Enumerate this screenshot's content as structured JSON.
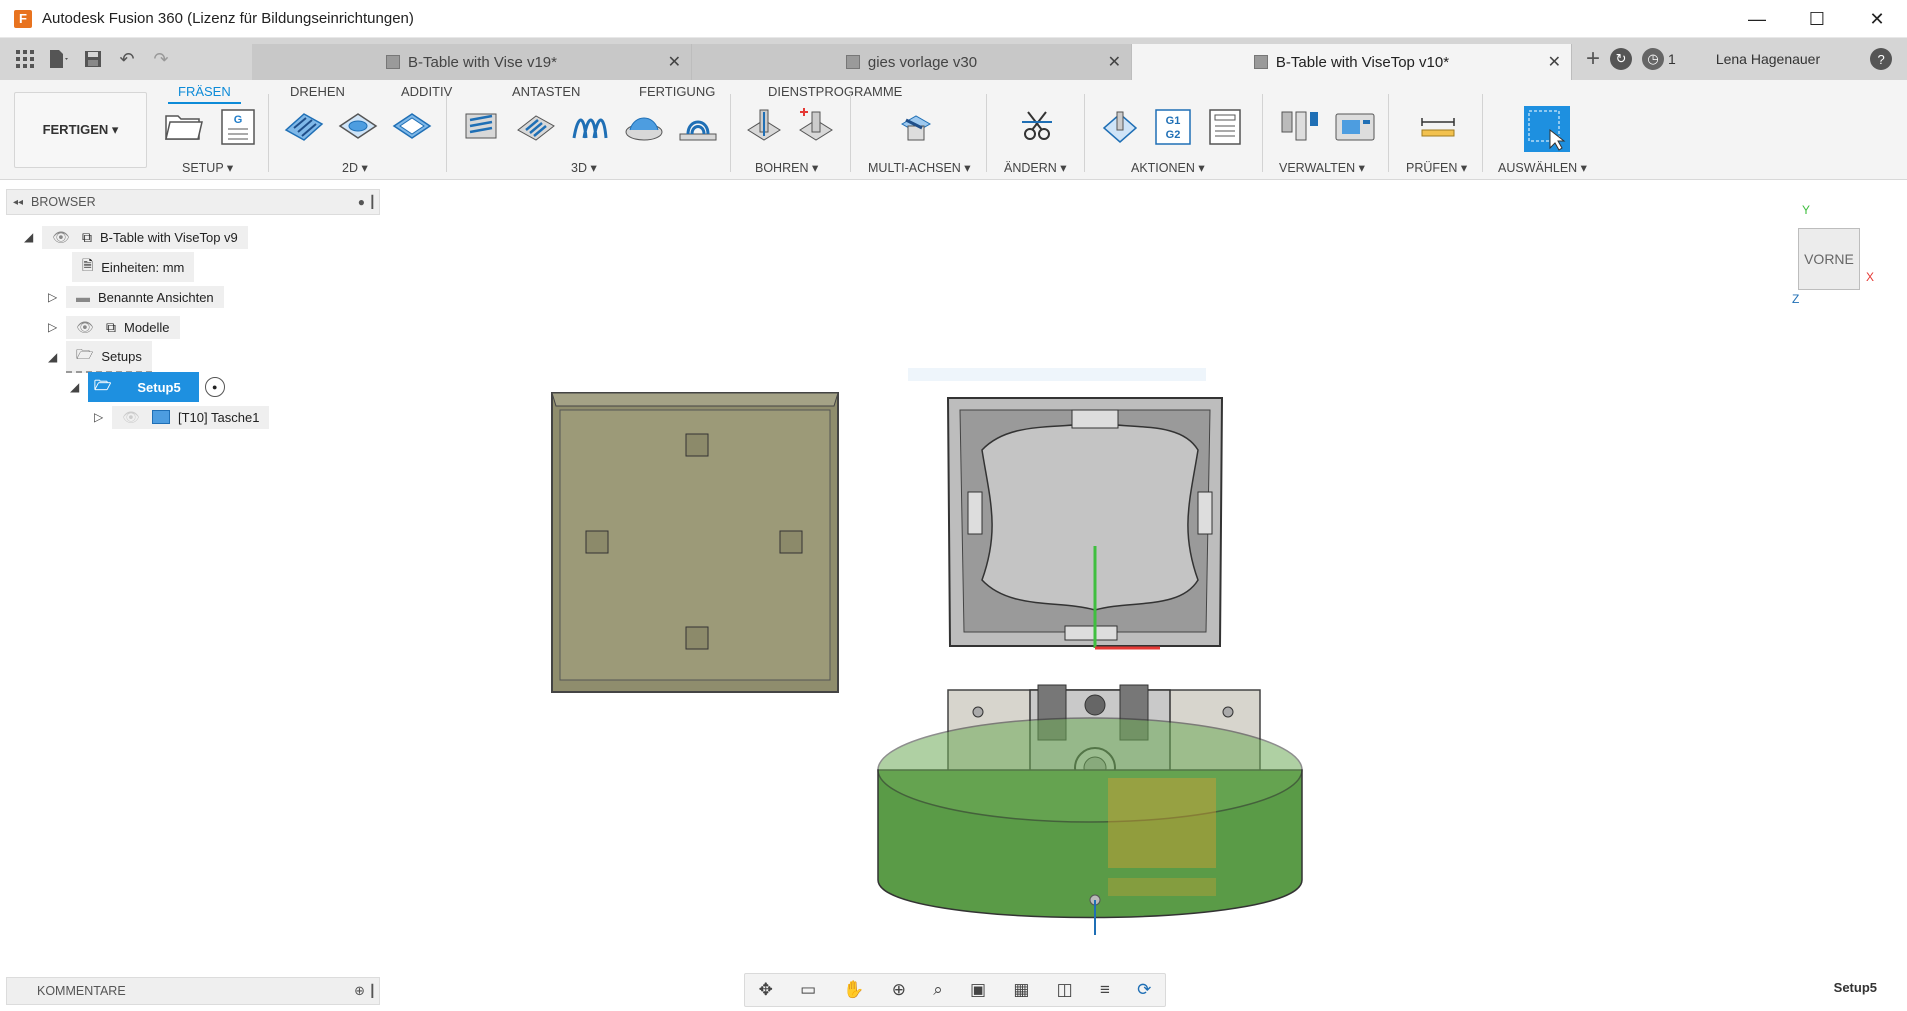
{
  "window": {
    "title": "Autodesk Fusion 360 (Lizenz für Bildungseinrichtungen)",
    "app_icon_letter": "F",
    "minimize": "—",
    "maximize": "☐",
    "close": "✕"
  },
  "tabs": [
    {
      "label": "B-Table with Vise v19*",
      "active": false
    },
    {
      "label": "gies vorlage v30",
      "active": false
    },
    {
      "label": "B-Table with ViseTop v10*",
      "active": true
    }
  ],
  "tab_close": "✕",
  "tabbar_right": {
    "new_tab": "+",
    "job_count": "1",
    "user": "Lena Hagenauer",
    "help": "?"
  },
  "toolbar": {
    "workspace": "FERTIGEN ▾",
    "ribbon_tabs": [
      "FRÄSEN",
      "DREHEN",
      "ADDITIV",
      "ANTASTEN",
      "FERTIGUNG",
      "DIENSTPROGRAMME"
    ],
    "groups": [
      "SETUP ▾",
      "2D ▾",
      "3D ▾",
      "BOHREN ▾",
      "MULTI-ACHSEN ▾",
      "ÄNDERN ▾",
      "AKTIONEN ▾",
      "VERWALTEN ▾",
      "PRÜFEN ▾",
      "AUSWÄHLEN ▾"
    ],
    "g1g2": "G1\nG2"
  },
  "browser": {
    "header": "BROWSER",
    "items": [
      {
        "label": "B-Table with ViseTop v9"
      },
      {
        "label": "Einheiten: mm"
      },
      {
        "label": "Benannte Ansichten"
      },
      {
        "label": "Modelle"
      },
      {
        "label": "Setups"
      },
      {
        "label": "Setup5"
      },
      {
        "label": "[T10] Tasche1"
      }
    ]
  },
  "comments": {
    "header": "KOMMENTARE"
  },
  "status": {
    "setup": "Setup5"
  },
  "viewcube": {
    "face": "VORNE",
    "axis_x": "X",
    "axis_y": "Y",
    "axis_z": "Z"
  },
  "colors": {
    "accent": "#0d8bd8",
    "selection": "#1e90e0",
    "fixture_green": "#4f8d3c",
    "stock_olive": "#8a8a6a"
  }
}
